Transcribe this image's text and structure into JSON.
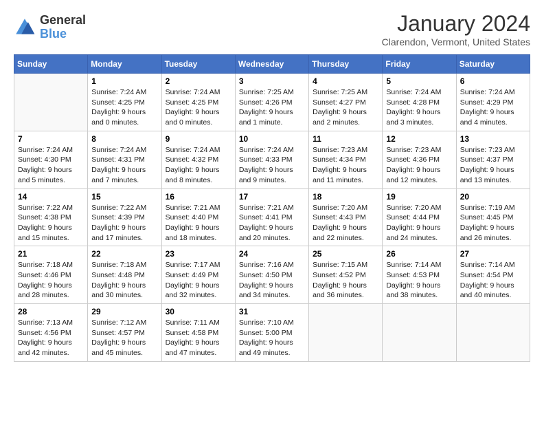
{
  "logo": {
    "general": "General",
    "blue": "Blue"
  },
  "title": "January 2024",
  "location": "Clarendon, Vermont, United States",
  "days_of_week": [
    "Sunday",
    "Monday",
    "Tuesday",
    "Wednesday",
    "Thursday",
    "Friday",
    "Saturday"
  ],
  "weeks": [
    [
      {
        "day": "",
        "empty": true,
        "content": ""
      },
      {
        "day": "1",
        "content": "Sunrise: 7:24 AM\nSunset: 4:25 PM\nDaylight: 9 hours\nand 0 minutes."
      },
      {
        "day": "2",
        "content": "Sunrise: 7:24 AM\nSunset: 4:25 PM\nDaylight: 9 hours\nand 0 minutes."
      },
      {
        "day": "3",
        "content": "Sunrise: 7:25 AM\nSunset: 4:26 PM\nDaylight: 9 hours\nand 1 minute."
      },
      {
        "day": "4",
        "content": "Sunrise: 7:25 AM\nSunset: 4:27 PM\nDaylight: 9 hours\nand 2 minutes."
      },
      {
        "day": "5",
        "content": "Sunrise: 7:24 AM\nSunset: 4:28 PM\nDaylight: 9 hours\nand 3 minutes."
      },
      {
        "day": "6",
        "content": "Sunrise: 7:24 AM\nSunset: 4:29 PM\nDaylight: 9 hours\nand 4 minutes."
      }
    ],
    [
      {
        "day": "7",
        "content": "Sunrise: 7:24 AM\nSunset: 4:30 PM\nDaylight: 9 hours\nand 5 minutes."
      },
      {
        "day": "8",
        "content": "Sunrise: 7:24 AM\nSunset: 4:31 PM\nDaylight: 9 hours\nand 7 minutes."
      },
      {
        "day": "9",
        "content": "Sunrise: 7:24 AM\nSunset: 4:32 PM\nDaylight: 9 hours\nand 8 minutes."
      },
      {
        "day": "10",
        "content": "Sunrise: 7:24 AM\nSunset: 4:33 PM\nDaylight: 9 hours\nand 9 minutes."
      },
      {
        "day": "11",
        "content": "Sunrise: 7:23 AM\nSunset: 4:34 PM\nDaylight: 9 hours\nand 11 minutes."
      },
      {
        "day": "12",
        "content": "Sunrise: 7:23 AM\nSunset: 4:36 PM\nDaylight: 9 hours\nand 12 minutes."
      },
      {
        "day": "13",
        "content": "Sunrise: 7:23 AM\nSunset: 4:37 PM\nDaylight: 9 hours\nand 13 minutes."
      }
    ],
    [
      {
        "day": "14",
        "content": "Sunrise: 7:22 AM\nSunset: 4:38 PM\nDaylight: 9 hours\nand 15 minutes."
      },
      {
        "day": "15",
        "content": "Sunrise: 7:22 AM\nSunset: 4:39 PM\nDaylight: 9 hours\nand 17 minutes."
      },
      {
        "day": "16",
        "content": "Sunrise: 7:21 AM\nSunset: 4:40 PM\nDaylight: 9 hours\nand 18 minutes."
      },
      {
        "day": "17",
        "content": "Sunrise: 7:21 AM\nSunset: 4:41 PM\nDaylight: 9 hours\nand 20 minutes."
      },
      {
        "day": "18",
        "content": "Sunrise: 7:20 AM\nSunset: 4:43 PM\nDaylight: 9 hours\nand 22 minutes."
      },
      {
        "day": "19",
        "content": "Sunrise: 7:20 AM\nSunset: 4:44 PM\nDaylight: 9 hours\nand 24 minutes."
      },
      {
        "day": "20",
        "content": "Sunrise: 7:19 AM\nSunset: 4:45 PM\nDaylight: 9 hours\nand 26 minutes."
      }
    ],
    [
      {
        "day": "21",
        "content": "Sunrise: 7:18 AM\nSunset: 4:46 PM\nDaylight: 9 hours\nand 28 minutes."
      },
      {
        "day": "22",
        "content": "Sunrise: 7:18 AM\nSunset: 4:48 PM\nDaylight: 9 hours\nand 30 minutes."
      },
      {
        "day": "23",
        "content": "Sunrise: 7:17 AM\nSunset: 4:49 PM\nDaylight: 9 hours\nand 32 minutes."
      },
      {
        "day": "24",
        "content": "Sunrise: 7:16 AM\nSunset: 4:50 PM\nDaylight: 9 hours\nand 34 minutes."
      },
      {
        "day": "25",
        "content": "Sunrise: 7:15 AM\nSunset: 4:52 PM\nDaylight: 9 hours\nand 36 minutes."
      },
      {
        "day": "26",
        "content": "Sunrise: 7:14 AM\nSunset: 4:53 PM\nDaylight: 9 hours\nand 38 minutes."
      },
      {
        "day": "27",
        "content": "Sunrise: 7:14 AM\nSunset: 4:54 PM\nDaylight: 9 hours\nand 40 minutes."
      }
    ],
    [
      {
        "day": "28",
        "content": "Sunrise: 7:13 AM\nSunset: 4:56 PM\nDaylight: 9 hours\nand 42 minutes."
      },
      {
        "day": "29",
        "content": "Sunrise: 7:12 AM\nSunset: 4:57 PM\nDaylight: 9 hours\nand 45 minutes."
      },
      {
        "day": "30",
        "content": "Sunrise: 7:11 AM\nSunset: 4:58 PM\nDaylight: 9 hours\nand 47 minutes."
      },
      {
        "day": "31",
        "content": "Sunrise: 7:10 AM\nSunset: 5:00 PM\nDaylight: 9 hours\nand 49 minutes."
      },
      {
        "day": "",
        "empty": true,
        "content": ""
      },
      {
        "day": "",
        "empty": true,
        "content": ""
      },
      {
        "day": "",
        "empty": true,
        "content": ""
      }
    ]
  ]
}
